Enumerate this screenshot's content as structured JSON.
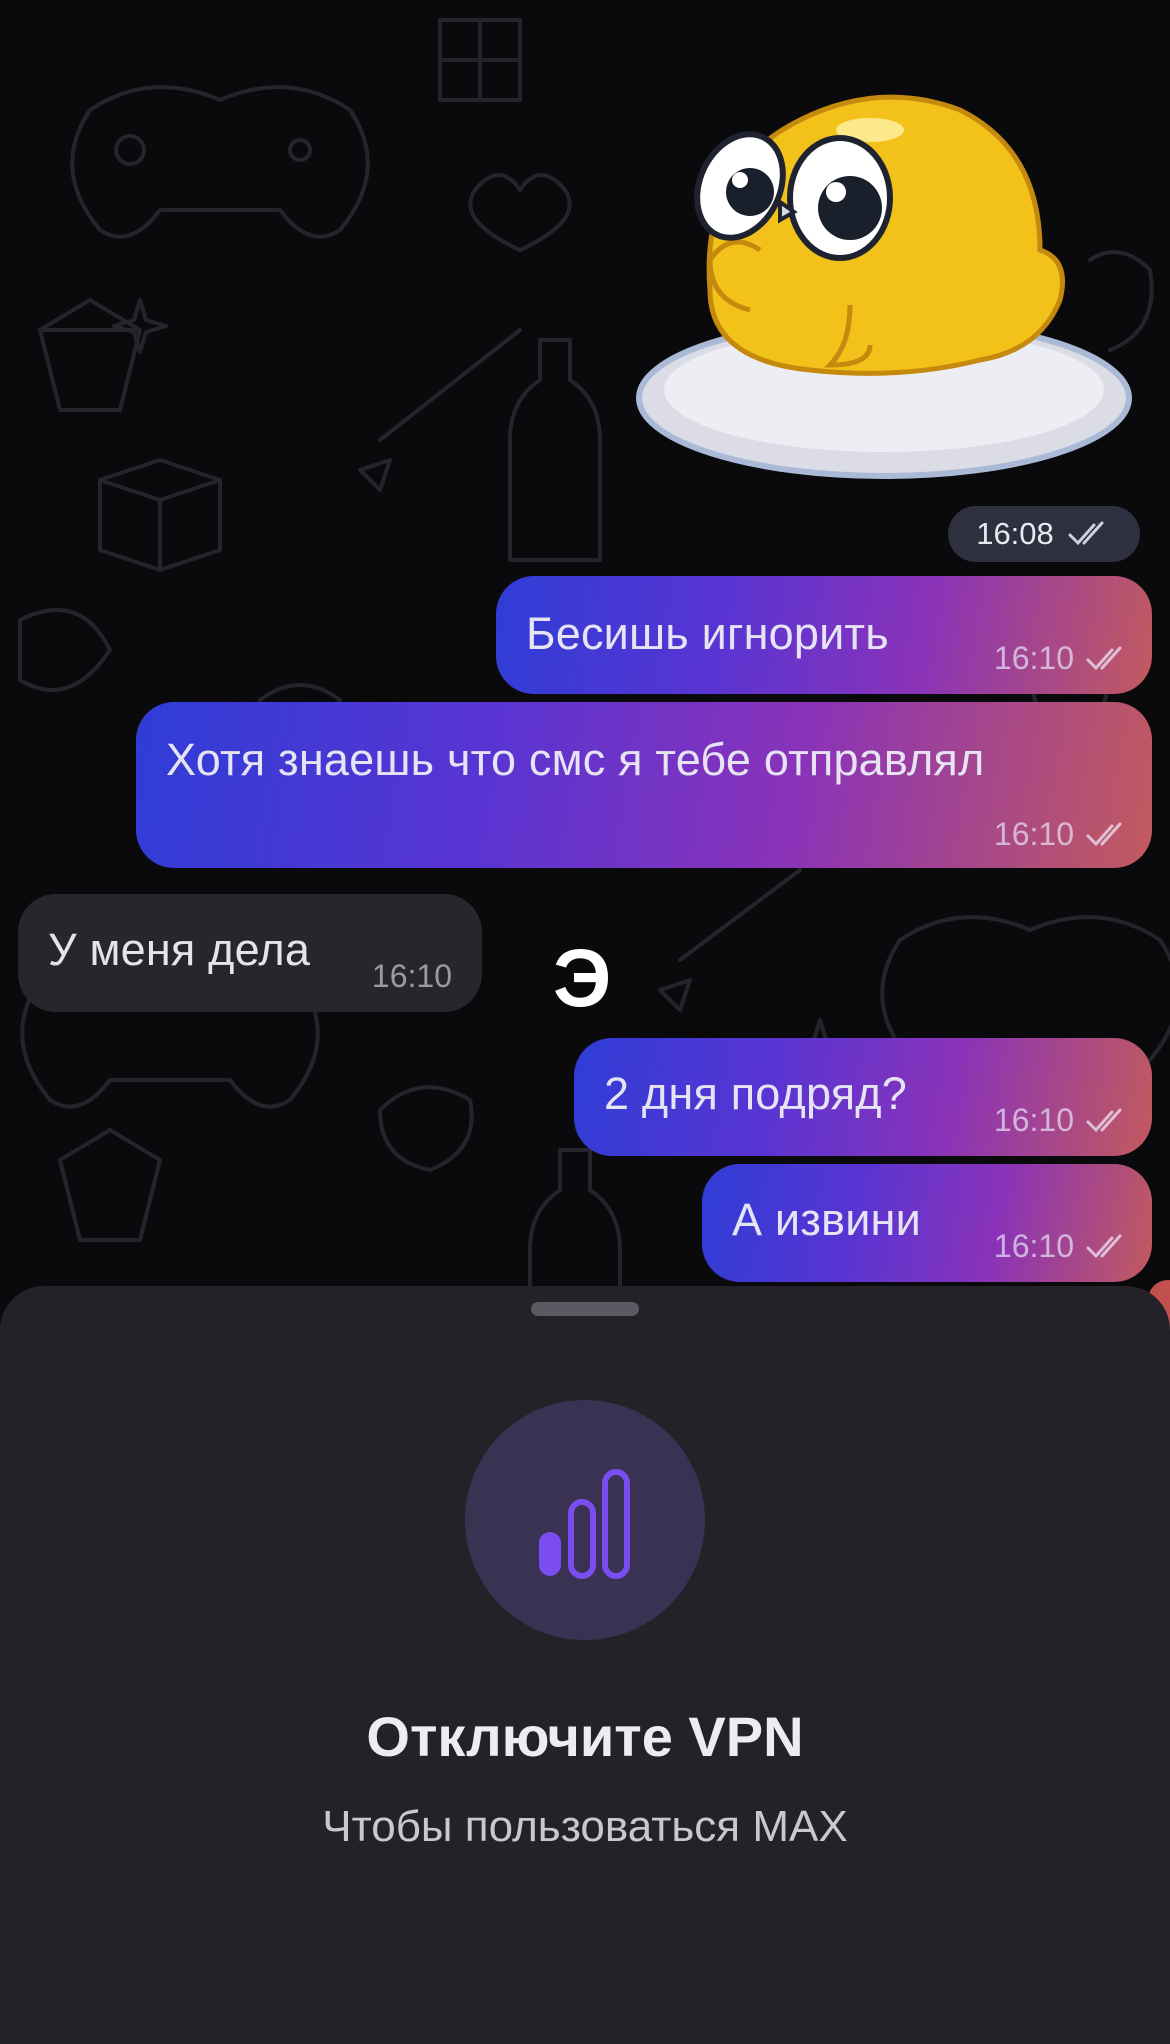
{
  "chat": {
    "sticker_time": "16:08",
    "messages": [
      {
        "direction": "outgoing",
        "text": "Бесишь игнорить",
        "time": "16:10"
      },
      {
        "direction": "outgoing",
        "text": "Хотя знаешь что смс я тебе отправлял",
        "time": "16:10"
      },
      {
        "direction": "incoming",
        "text": "У меня дела",
        "time": "16:10"
      },
      {
        "direction": "outgoing",
        "text": "2 дня подряд?",
        "time": "16:10"
      },
      {
        "direction": "outgoing",
        "text": "А извини",
        "time": "16:10"
      }
    ],
    "floating_char": "Э"
  },
  "sheet": {
    "icon": "signal-bars-icon",
    "title": "Отключите VPN",
    "subtitle": "Чтобы пользоваться MAX"
  },
  "colors": {
    "outgoing_gradient": [
      "#2f3dd6",
      "#8a33b8",
      "#c25a5e"
    ],
    "incoming_bubble": "#26262c",
    "sheet_bg": "#232229",
    "icon_circle": "#3a3253",
    "icon_accent": "#7b4cf0"
  }
}
